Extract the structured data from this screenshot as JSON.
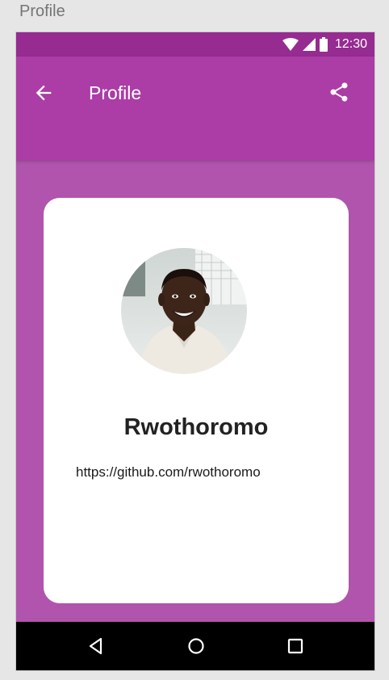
{
  "window": {
    "title": "Profile"
  },
  "status_bar": {
    "time": "12:30"
  },
  "app_bar": {
    "title": "Profile"
  },
  "profile": {
    "name": "Rwothoromo",
    "link": "https://github.com/rwothoromo"
  },
  "colors": {
    "status_bar": "#962b91",
    "app_bar": "#ac3ca6",
    "background": "#b154ad",
    "card": "#ffffff",
    "nav_bar": "#000000"
  },
  "icons": [
    "wifi-icon",
    "signal-icon",
    "battery-icon",
    "back-arrow-icon",
    "share-icon",
    "nav-back-icon",
    "nav-home-icon",
    "nav-recents-icon"
  ]
}
